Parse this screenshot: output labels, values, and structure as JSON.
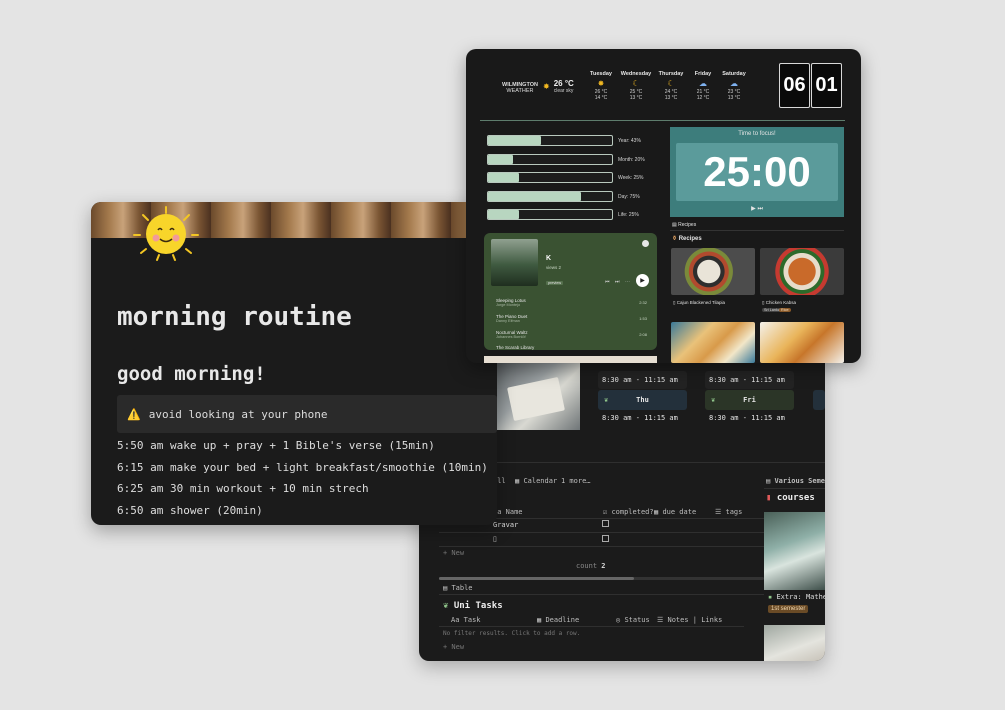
{
  "routine": {
    "title": "morning routine",
    "heading": "good morning!",
    "callout": "avoid looking at your phone",
    "items": [
      "5:50 am wake up + pray + 1 Bible's verse (15min)",
      "6:15 am make your bed + light breakfast/smoothie (10min)",
      "6:25 am 30 min workout + 10 min strech",
      "6:50 am shower (20min)"
    ]
  },
  "weather": {
    "location": "WILMINGTON",
    "label": "WEATHER",
    "current_temp": "26 °C",
    "current_desc": "clear sky",
    "days": [
      {
        "name": "Tuesday",
        "icon": "sun-icon",
        "hi": "26 °C",
        "lo": "14 °C"
      },
      {
        "name": "Wednesday",
        "icon": "moon-icon",
        "hi": "25 °C",
        "lo": "13 °C"
      },
      {
        "name": "Thursday",
        "icon": "moon-icon",
        "hi": "24 °C",
        "lo": "13 °C"
      },
      {
        "name": "Friday",
        "icon": "cloud-icon",
        "hi": "21 °C",
        "lo": "12 °C"
      },
      {
        "name": "Saturday",
        "icon": "cloud-icon",
        "hi": "23 °C",
        "lo": "13 °C"
      }
    ]
  },
  "clock": {
    "hours": "06",
    "minutes": "01"
  },
  "progress": [
    {
      "label": "Year: 43%",
      "value": 43
    },
    {
      "label": "Month: 20%",
      "value": 20
    },
    {
      "label": "Week: 25%",
      "value": 25
    },
    {
      "label": "Day: 75%",
      "value": 75
    },
    {
      "label": "Life: 25%",
      "value": 25
    }
  ],
  "timer": {
    "title": "Time to focus!",
    "time": "25:00",
    "controls": "▶ ⏭"
  },
  "player": {
    "track_title": "K",
    "artist": "views 2",
    "tag": "preview",
    "tracks": [
      {
        "name": "Sleeping Lotus",
        "artist": "Jorge Montejo",
        "duration": "2:32"
      },
      {
        "name": "The Piano Duet",
        "artist": "Danny Elfman",
        "duration": "1:53"
      },
      {
        "name": "Nocturnal Waltz",
        "artist": "Johannes Bornlöf",
        "duration": "2:08"
      },
      {
        "name": "The Scarab Library",
        "artist": "",
        "duration": ""
      }
    ]
  },
  "recipes": {
    "tab": "Recipes",
    "heading": "Recipes",
    "items": [
      {
        "name": "Cajun Blackened Tilapia",
        "tags": []
      },
      {
        "name": "Chicken Kabsa",
        "tags": [
          "Sri Lanka",
          "Rice"
        ]
      }
    ]
  },
  "schedule": {
    "time_range": "8:30 am - 11:15 am",
    "days": [
      "Thu",
      "Fri"
    ]
  },
  "tasks_db": {
    "view_all": "all",
    "view_calendar": "Calendar",
    "view_more": "1 more…",
    "columns": [
      "Name",
      "completed?",
      "due date",
      "tags"
    ],
    "rows": [
      "Gravar",
      ""
    ],
    "new_label": "+ New",
    "count_label": "count",
    "count_value": "2"
  },
  "uni": {
    "view": "Table",
    "title": "Uni Tasks",
    "columns": [
      "Task",
      "Deadline",
      "Status",
      "Notes | Links"
    ],
    "empty": "No filter results. Click to add a row.",
    "new_label": "+ New"
  },
  "courses": {
    "tab": "Various Semest",
    "title": "courses",
    "item_name": "Extra: Mathem",
    "item_badge": "1st semester"
  },
  "colors": {
    "timer_bg": "#3d7d7c",
    "player_bg": "#3a5232",
    "progress_fill": "#b8d6c0"
  }
}
